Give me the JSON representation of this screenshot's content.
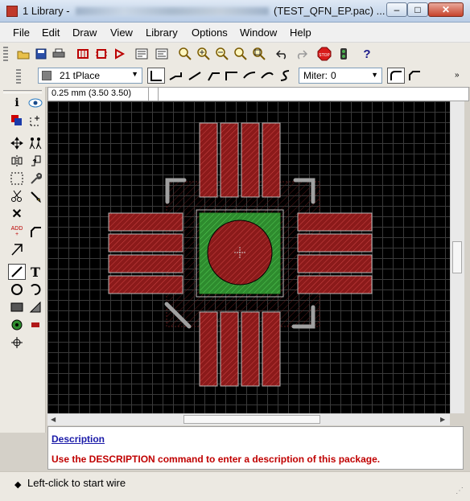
{
  "window": {
    "title": "1 Library - ",
    "title_obscured": "",
    "file": "(TEST_QFN_EP.pac) ...",
    "minimize_glyph": "–",
    "maximize_glyph": "□",
    "close_glyph": "✕"
  },
  "menu": {
    "file": "File",
    "edit": "Edit",
    "draw": "Draw",
    "view": "View",
    "library": "Library",
    "options": "Options",
    "window": "Window",
    "help": "Help"
  },
  "toolbar2": {
    "layer": "21 tPlace",
    "layer_color": "#808080",
    "miter_label": "Miter:",
    "miter_value": "0"
  },
  "coord": {
    "readout": "0.25 mm (3.50 3.50)"
  },
  "description": {
    "link": "Description",
    "message": "Use the DESCRIPTION command to enter a description of this package."
  },
  "status": {
    "text": "Left-click to start wire"
  },
  "colors": {
    "pad_red": "#8b1a1a",
    "pad_outline": "#b8b8b8",
    "exposed_pad_green": "#2e8b2e",
    "grid": "#3a3a3a",
    "background": "#000000",
    "link_blue": "#1a1aa8",
    "message_red": "#c00000"
  }
}
